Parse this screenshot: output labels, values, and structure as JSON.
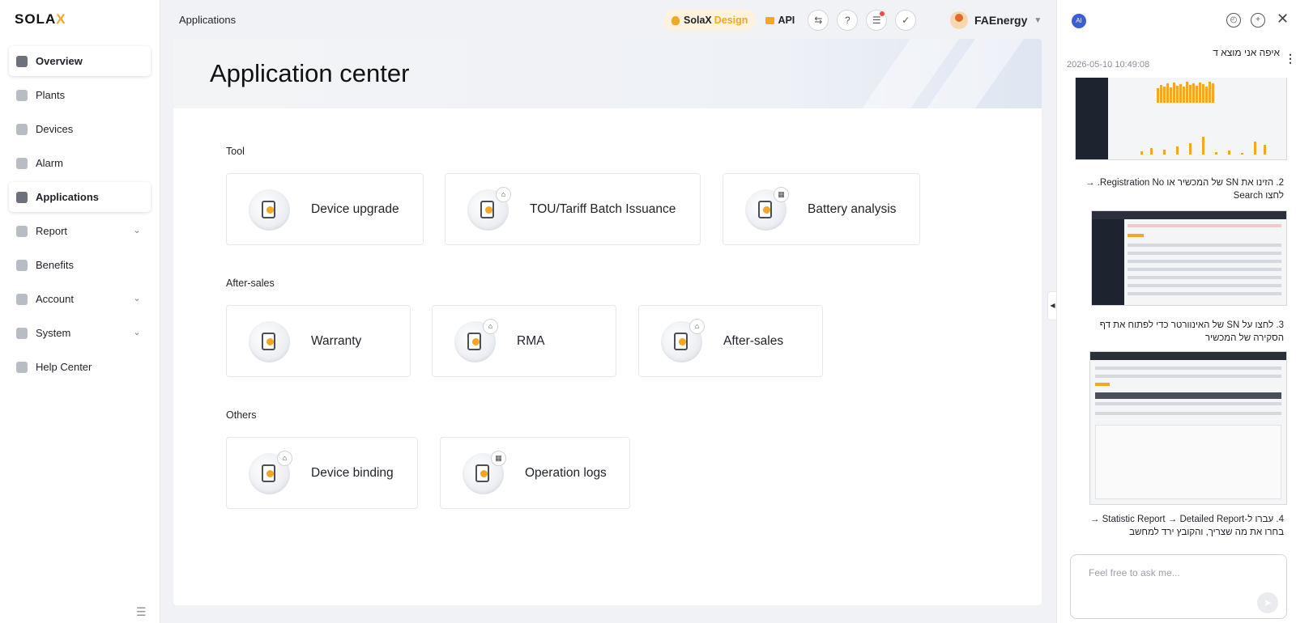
{
  "brand": {
    "logo_main": "SOLA",
    "logo_x": "X"
  },
  "sidebar": {
    "items": [
      {
        "label": "Overview",
        "active": false,
        "icon": "overview-icon",
        "chevron": false
      },
      {
        "label": "Plants",
        "icon": "plants-icon",
        "chevron": false
      },
      {
        "label": "Devices",
        "icon": "devices-icon",
        "chevron": false
      },
      {
        "label": "Alarm",
        "icon": "alarm-icon",
        "chevron": false
      },
      {
        "label": "Applications",
        "active": true,
        "icon": "applications-icon",
        "chevron": false
      },
      {
        "label": "Report",
        "icon": "report-icon",
        "chevron": true
      },
      {
        "label": "Benefits",
        "icon": "benefits-icon",
        "chevron": false
      },
      {
        "label": "Account",
        "icon": "account-icon",
        "chevron": true
      },
      {
        "label": "System",
        "icon": "system-icon",
        "chevron": true
      },
      {
        "label": "Help Center",
        "icon": "help-center-icon",
        "chevron": false
      }
    ]
  },
  "header": {
    "breadcrumb": "Applications",
    "design_pill": {
      "brand": "SolaX",
      "suffix": "Design"
    },
    "api_label": "API",
    "user_name": "FAEnergy"
  },
  "main": {
    "title": "Application center",
    "sections": [
      {
        "title": "Tool",
        "cards": [
          {
            "label": "Device upgrade",
            "badge": false
          },
          {
            "label": "TOU/Tariff Batch Issuance",
            "badge": true
          },
          {
            "label": "Battery analysis",
            "badge": true
          }
        ]
      },
      {
        "title": "After-sales",
        "cards": [
          {
            "label": "Warranty",
            "badge": false
          },
          {
            "label": "RMA",
            "badge": true
          },
          {
            "label": "After-sales",
            "badge": true
          }
        ]
      },
      {
        "title": "Others",
        "cards": [
          {
            "label": "Device binding",
            "badge": true
          },
          {
            "label": "Operation logs",
            "badge": true
          }
        ]
      }
    ]
  },
  "chat": {
    "bot_avatar": "AI",
    "conversation_title": "איפה אני מוצא ד",
    "conversation_date": "2026-05-10 10:49:08",
    "steps": [
      {
        "num": "2.",
        "text": "הזינו את SN של המכשיר או Registration No. → לחצו Search"
      },
      {
        "num": "3.",
        "text": "לחצו על SN של האינוורטר כדי לפתוח את דף הסקירה של המכשיר"
      },
      {
        "num": "4.",
        "text": "עברו ל-Statistic Report → Detailed Report → בחרו את מה שצריך, והקובץ ירד למחשב"
      }
    ],
    "input_placeholder": "Feel free to ask me..."
  },
  "colors": {
    "accent": "#f5a623",
    "text": "#1f2329",
    "bg": "#f0f2f5"
  }
}
